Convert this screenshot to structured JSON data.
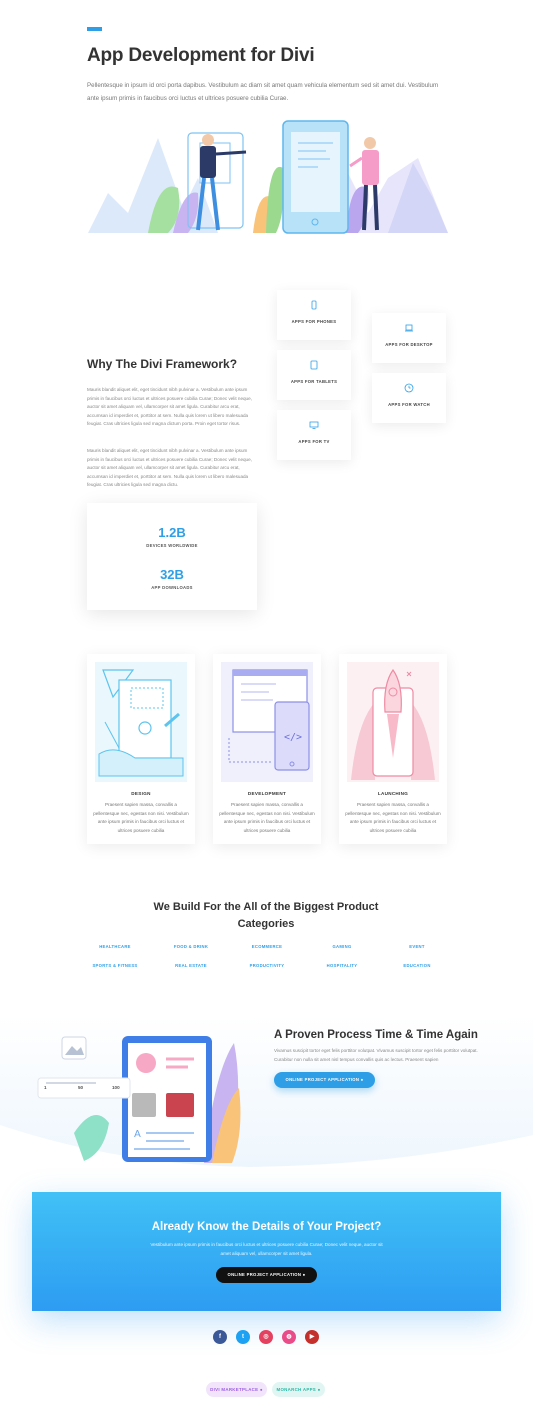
{
  "hero": {
    "title": "App Development for Divi",
    "text": "Pellentesque in ipsum id orci porta dapibus. Vestibulum ac diam sit amet quam vehicula elementum sed sit amet dui. Vestibulum ante ipsum primis in faucibus orci luctus et ultrices posuere cubilia Curae.",
    "accent_color": "#2e9fe7"
  },
  "why": {
    "title": "Why The Divi Framework?",
    "paragraph1": "Mauris blandit aliquet elit, eget tincidunt nibh pulvinar a. Vestibulum ante ipsum primis in faucibus orci luctus et ultrices posuere cubilia Curae; Donec velit neque, auctor sit amet aliquam vel, ullamcorper sit amet ligula. Curabitur arcu erat, accumsan id imperdiet et, porttitor at sem. Nulla quis lorem ut libero malesuada feugiat. Cras ultricies ligula sed magna dictum porta. Proin eget tortor risus.",
    "paragraph2": "Mauris blandit aliquet elit, eget tincidunt nibh pulvinar a. Vestibulum ante ipsum primis in faucibus orci luctus et ultrices posuere cubilia Curae; Donec velit neque, auctor sit amet aliquam vel, ullamcorper sit amet ligula. Curabitur arcu erat, accumsan id imperdiet et, porttitor at sem. Nulla quis lorem ut libero malesuada feugiat. Cras ultricies ligula sed magna dictu."
  },
  "app_cards": {
    "phones": {
      "label": "APPS FOR PHONES",
      "icon": "phone-icon"
    },
    "desktop": {
      "label": "APPS FOR DESKTOP",
      "icon": "laptop-icon"
    },
    "tablets": {
      "label": "APPS FOR TABLETS",
      "icon": "tablet-icon"
    },
    "watch": {
      "label": "APPS FOR WATCH",
      "icon": "clock-icon"
    },
    "tv": {
      "label": "APPS FOR TV",
      "icon": "tv-icon"
    }
  },
  "stats": [
    {
      "value": "1.2B",
      "label": "DEVICES WORLDWIDE"
    },
    {
      "value": "32B",
      "label": "APP DOWNLOADS"
    }
  ],
  "process": [
    {
      "title": "DESIGN",
      "text": "Praesent sapien massa, convallis a pellentesque nec, egestas non nisi. Vestibulum ante ipsum primis in faucibus orci luctus et ultrices posuere cubilia"
    },
    {
      "title": "DEVELOPMENT",
      "text": "Praesent sapien massa, convallis a pellentesque nec, egestas non nisi. Vestibulum ante ipsum primis in faucibus orci luctus et ultrices posuere cubilia"
    },
    {
      "title": "LAUNCHING",
      "text": "Praesent sapien massa, convallis a pellentesque nec, egestas non nisi. Vestibulum ante ipsum primis in faucibus orci luctus et ultrices posuere cubilia"
    }
  ],
  "categories": {
    "title": "We Build For the All of the Biggest Product Categories",
    "row1": [
      "HEALTHCARE",
      "FOOD & DRINK",
      "ECOMMERCE",
      "GAMING",
      "EVENT"
    ],
    "row2": [
      "SPORTS & FITNESS",
      "REAL ESTATE",
      "PRODUCTIVITY",
      "HOSPITALITY",
      "EDUCATION"
    ]
  },
  "proven": {
    "title": "A Proven Process Time & Time Again",
    "text": "Vivamus suscipit tortor eget felis porttitor volutpat. Vivamus suscipit tortor eget felis porttitor volutpat. Curabitur non nulla sit amet nisl tempus convallis quis ac lectus. Praesent sapien",
    "button": "ONLINE PROJECT APPLICATION",
    "slider_values": [
      "1",
      "50",
      "100"
    ]
  },
  "cta": {
    "title": "Already Know the Details of Your Project?",
    "text": "Vestibulum ante ipsum primis in faucibus orci luctus et ultrices posuere cubilia Curae; Donec velit neque, auctor sit amet aliquam vel, ullamcorper sit amet ligula.",
    "button": "ONLINE PROJECT APPLICATION"
  },
  "social": [
    {
      "name": "facebook",
      "glyph": "f",
      "color": "#3b5998"
    },
    {
      "name": "twitter",
      "glyph": "t",
      "color": "#1da1f2"
    },
    {
      "name": "instagram",
      "glyph": "◎",
      "color": "#e4405f"
    },
    {
      "name": "dribbble",
      "glyph": "◍",
      "color": "#ea4c89"
    },
    {
      "name": "youtube",
      "glyph": "▶",
      "color": "#c4302b"
    }
  ],
  "footer": {
    "divi_marketplace": "DIVI MARKETPLACE",
    "monarch_apps": "MONARCH APPS"
  }
}
